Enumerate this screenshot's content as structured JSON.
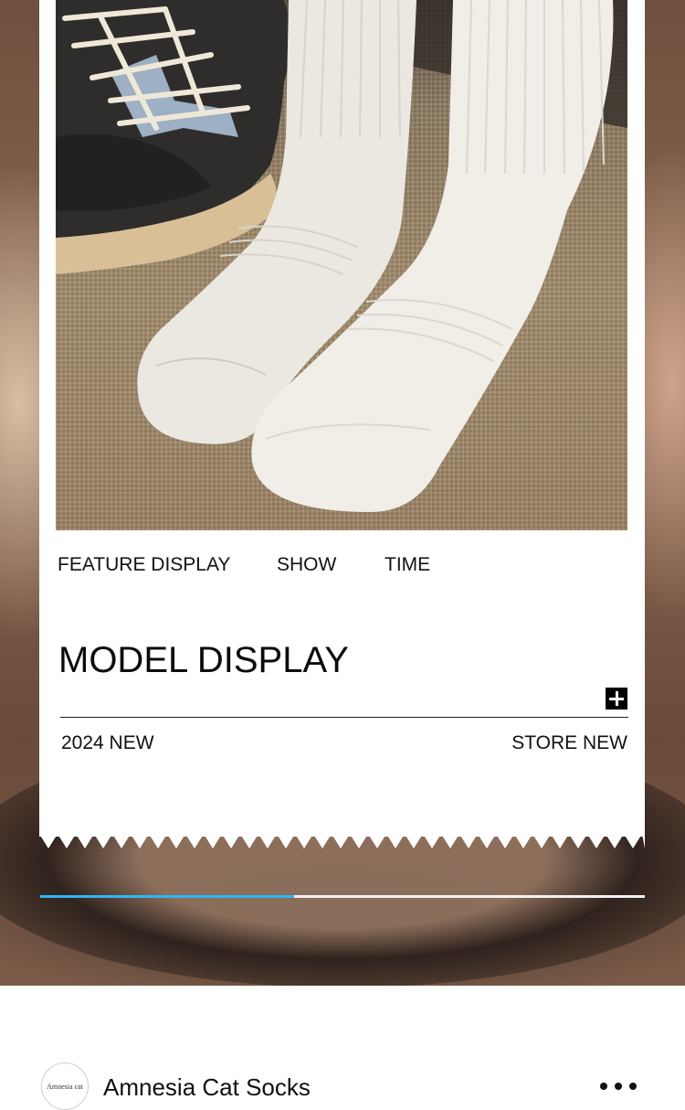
{
  "product": {
    "image_alt": "White ribbed crew socks next to dark sneakers on a woven mat"
  },
  "tabs": [
    "FEATURE DISPLAY",
    "SHOW",
    "TIME"
  ],
  "section": {
    "title": "MODEL DISPLAY",
    "left_caption": "2024 NEW",
    "right_caption": "STORE NEW",
    "expand_icon": "plus-icon"
  },
  "carousel": {
    "progress": 0.42,
    "accent_color": "#2eb7f5"
  },
  "store": {
    "avatar_text": "Amnesia cat",
    "name": "Amnesia Cat Socks",
    "menu_icon": "more-icon"
  }
}
